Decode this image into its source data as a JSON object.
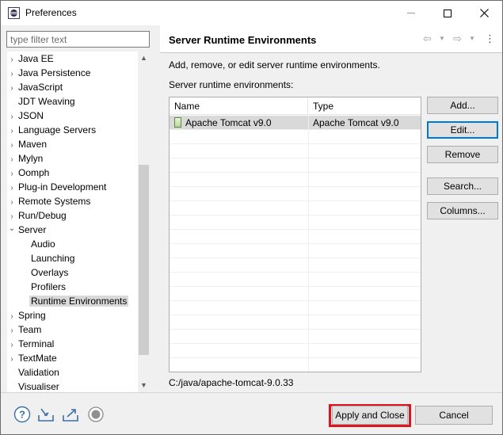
{
  "window": {
    "title": "Preferences",
    "app_icon": "eclipse-icon",
    "controls": [
      "minimize-icon",
      "maximize-icon",
      "close-icon"
    ]
  },
  "sidebar": {
    "filter_placeholder": "type filter text",
    "items": [
      {
        "label": "Java EE",
        "expandable": true,
        "expanded": false,
        "level": 0
      },
      {
        "label": "Java Persistence",
        "expandable": true,
        "expanded": false,
        "level": 0
      },
      {
        "label": "JavaScript",
        "expandable": true,
        "expanded": false,
        "level": 0
      },
      {
        "label": "JDT Weaving",
        "expandable": false,
        "expanded": false,
        "level": 0
      },
      {
        "label": "JSON",
        "expandable": true,
        "expanded": false,
        "level": 0
      },
      {
        "label": "Language Servers",
        "expandable": true,
        "expanded": false,
        "level": 0
      },
      {
        "label": "Maven",
        "expandable": true,
        "expanded": false,
        "level": 0
      },
      {
        "label": "Mylyn",
        "expandable": true,
        "expanded": false,
        "level": 0
      },
      {
        "label": "Oomph",
        "expandable": true,
        "expanded": false,
        "level": 0
      },
      {
        "label": "Plug-in Development",
        "expandable": true,
        "expanded": false,
        "level": 0
      },
      {
        "label": "Remote Systems",
        "expandable": true,
        "expanded": false,
        "level": 0
      },
      {
        "label": "Run/Debug",
        "expandable": true,
        "expanded": false,
        "level": 0
      },
      {
        "label": "Server",
        "expandable": true,
        "expanded": true,
        "level": 0
      },
      {
        "label": "Audio",
        "expandable": false,
        "expanded": false,
        "level": 1
      },
      {
        "label": "Launching",
        "expandable": false,
        "expanded": false,
        "level": 1
      },
      {
        "label": "Overlays",
        "expandable": false,
        "expanded": false,
        "level": 1
      },
      {
        "label": "Profilers",
        "expandable": false,
        "expanded": false,
        "level": 1
      },
      {
        "label": "Runtime Environments",
        "expandable": false,
        "expanded": false,
        "level": 1,
        "selected": true
      },
      {
        "label": "Spring",
        "expandable": true,
        "expanded": false,
        "level": 0
      },
      {
        "label": "Team",
        "expandable": true,
        "expanded": false,
        "level": 0
      },
      {
        "label": "Terminal",
        "expandable": true,
        "expanded": false,
        "level": 0
      },
      {
        "label": "TextMate",
        "expandable": true,
        "expanded": false,
        "level": 0
      },
      {
        "label": "Validation",
        "expandable": false,
        "expanded": false,
        "level": 0
      },
      {
        "label": "Visualiser",
        "expandable": false,
        "expanded": false,
        "level": 0
      }
    ]
  },
  "page": {
    "title": "Server Runtime Environments",
    "description": "Add, remove, or edit server runtime environments.",
    "list_label": "Server runtime environments:",
    "columns": [
      "Name",
      "Type"
    ],
    "rows": [
      {
        "name": "Apache Tomcat v9.0",
        "type": "Apache Tomcat v9.0",
        "selected": true
      }
    ],
    "selected_path": "C:/java/apache-tomcat-9.0.33",
    "buttons": {
      "add": "Add...",
      "edit": "Edit...",
      "remove": "Remove",
      "search": "Search...",
      "columns": "Columns..."
    },
    "nav_icons": [
      "back-arrow-icon",
      "back-menu-icon",
      "forward-arrow-icon",
      "forward-menu-icon",
      "view-menu-icon"
    ]
  },
  "footer": {
    "icons": [
      "help-icon",
      "import-icon",
      "export-icon",
      "record-icon"
    ],
    "apply_close": "Apply and Close",
    "cancel": "Cancel",
    "highlight_color": "#e0141e"
  }
}
